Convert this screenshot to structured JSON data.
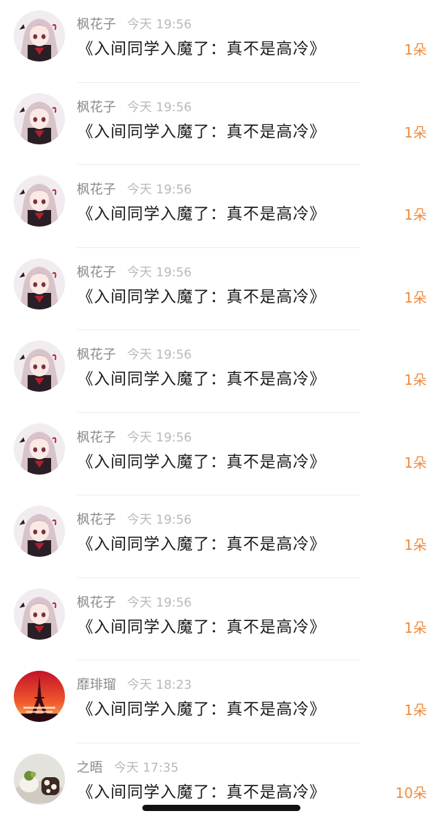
{
  "colors": {
    "name": "#8a8a8a",
    "time": "#b9b9b9",
    "title": "#1b1b1b",
    "count": "#f08a3c",
    "divider": "#ececec"
  },
  "gifts": [
    {
      "name": "枫花子",
      "time": "今天 19:56",
      "title": "《入间同学入魔了：真不是高冷》",
      "count": "1朵",
      "avatar": "anime-girl-avatar"
    },
    {
      "name": "枫花子",
      "time": "今天 19:56",
      "title": "《入间同学入魔了：真不是高冷》",
      "count": "1朵",
      "avatar": "anime-girl-avatar"
    },
    {
      "name": "枫花子",
      "time": "今天 19:56",
      "title": "《入间同学入魔了：真不是高冷》",
      "count": "1朵",
      "avatar": "anime-girl-avatar"
    },
    {
      "name": "枫花子",
      "time": "今天 19:56",
      "title": "《入间同学入魔了：真不是高冷》",
      "count": "1朵",
      "avatar": "anime-girl-avatar"
    },
    {
      "name": "枫花子",
      "time": "今天 19:56",
      "title": "《入间同学入魔了：真不是高冷》",
      "count": "1朵",
      "avatar": "anime-girl-avatar"
    },
    {
      "name": "枫花子",
      "time": "今天 19:56",
      "title": "《入间同学入魔了：真不是高冷》",
      "count": "1朵",
      "avatar": "anime-girl-avatar"
    },
    {
      "name": "枫花子",
      "time": "今天 19:56",
      "title": "《入间同学入魔了：真不是高冷》",
      "count": "1朵",
      "avatar": "anime-girl-avatar"
    },
    {
      "name": "枫花子",
      "time": "今天 19:56",
      "title": "《入间同学入魔了：真不是高冷》",
      "count": "1朵",
      "avatar": "anime-girl-avatar"
    },
    {
      "name": "靡琲瑠",
      "time": "今天 18:23",
      "title": "《入间同学入魔了：真不是高冷》",
      "count": "1朵",
      "avatar": "eiffel-tower-sunset-avatar"
    },
    {
      "name": "之晤",
      "time": "今天 17:35",
      "title": "《入间同学入魔了：真不是高冷》",
      "count": "10朵",
      "avatar": "food-photo-avatar"
    }
  ]
}
